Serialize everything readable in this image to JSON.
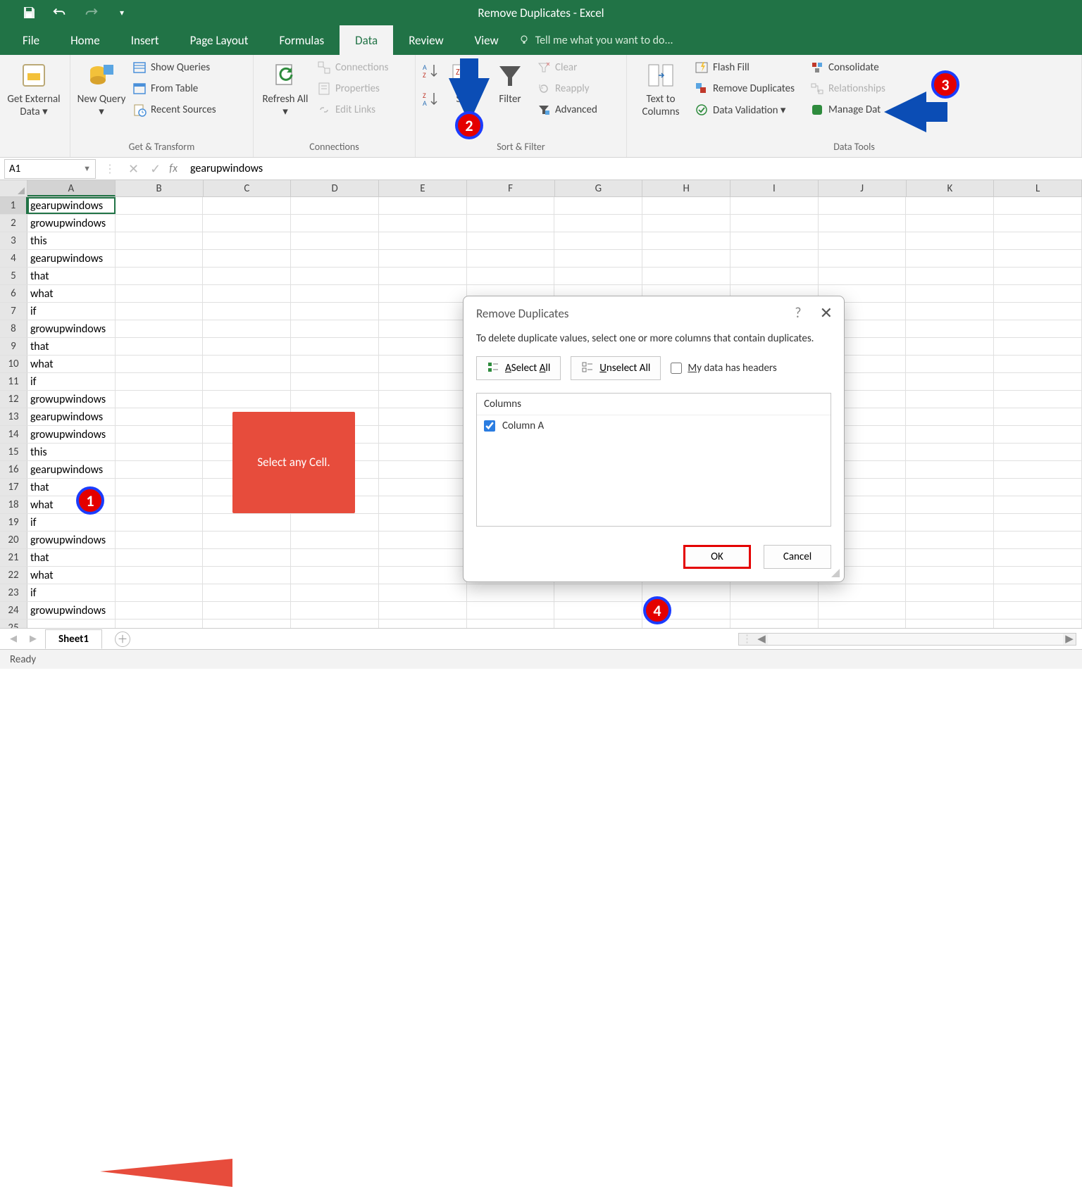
{
  "app_title": "Remove Duplicates - Excel",
  "tabs": {
    "file": "File",
    "home": "Home",
    "insert": "Insert",
    "pagelayout": "Page Layout",
    "formulas": "Formulas",
    "data": "Data",
    "review": "Review",
    "view": "View",
    "tell": "Tell me what you want to do..."
  },
  "ribbon": {
    "getexternal": "Get External Data ▾",
    "newquery": "New Query ▾",
    "showqueries": "Show Queries",
    "fromtable": "From Table",
    "recentsources": "Recent Sources",
    "group_get": "Get & Transform",
    "refresh": "Refresh All ▾",
    "connections": "Connections",
    "properties": "Properties",
    "editlinks": "Edit Links",
    "group_conn": "Connections",
    "sort": "Sort",
    "filter": "Filter",
    "clear": "Clear",
    "reapply": "Reapply",
    "advanced": "Advanced",
    "group_sort": "Sort & Filter",
    "texttocols": "Text to Columns",
    "flashfill": "Flash Fill",
    "removedup": "Remove Duplicates",
    "datavalid": "Data Validation   ▾",
    "consolidate": "Consolidate",
    "relationships": "Relationships",
    "managedata": "Manage Dat",
    "group_tools": "Data Tools"
  },
  "namebox": "A1",
  "formula_value": "gearupwindows",
  "columns": [
    "A",
    "B",
    "C",
    "D",
    "E",
    "F",
    "G",
    "H",
    "I",
    "J",
    "K",
    "L"
  ],
  "cells": [
    "gearupwindows",
    "growupwindows",
    "this",
    "gearupwindows",
    "that",
    "what",
    "if",
    "growupwindows",
    "that",
    "what",
    "if",
    "growupwindows",
    "gearupwindows",
    "growupwindows",
    "this",
    "gearupwindows",
    "that",
    "what",
    "if",
    "growupwindows",
    "that",
    "what",
    "if",
    "growupwindows",
    ""
  ],
  "callout1": "Select any Cell.",
  "dialog": {
    "title": "Remove Duplicates",
    "instr": "To delete duplicate values, select one or more columns that contain duplicates.",
    "selectall": "Select All",
    "unselectall": "Unselect All",
    "headers_pre": "M",
    "headers_rest": "y data has headers",
    "colhdr": "Columns",
    "col_a": "Column A",
    "ok": "OK",
    "cancel": "Cancel"
  },
  "sheet_tab": "Sheet1",
  "status": "Ready"
}
